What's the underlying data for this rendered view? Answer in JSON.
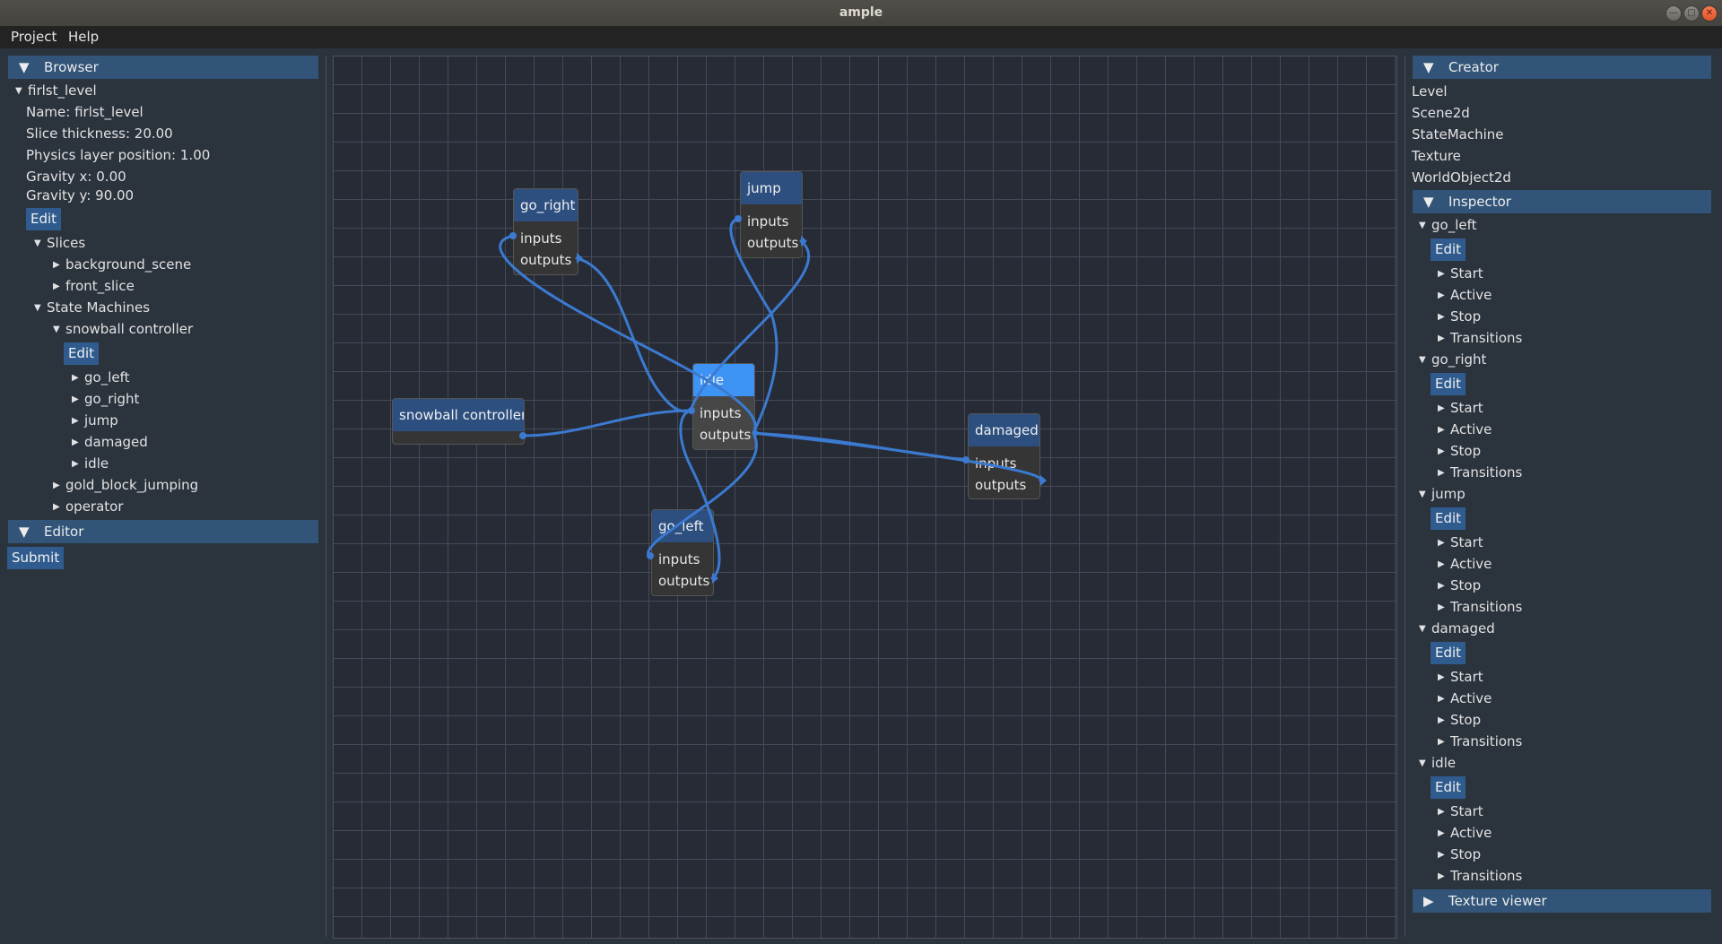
{
  "window": {
    "title": "ample"
  },
  "menubar": {
    "items": [
      "Project",
      "Help"
    ]
  },
  "browser": {
    "header": "Browser",
    "level": {
      "label": "firlst_level",
      "name": "Name: firlst_level",
      "slice_thickness": "Slice thickness: 20.00",
      "physics_layer": "Physics layer position: 1.00",
      "gravity_x": "Gravity x: 0.00",
      "gravity_y": "Gravity y: 90.00",
      "edit": "Edit"
    },
    "slices": {
      "label": "Slices",
      "items": [
        "background_scene",
        "front_slice"
      ]
    },
    "state_machines": {
      "label": "State Machines",
      "snowball": {
        "label": "snowball controller",
        "edit": "Edit",
        "states": [
          "go_left",
          "go_right",
          "jump",
          "damaged",
          "idle"
        ]
      },
      "others": [
        "gold_block_jumping",
        "operator"
      ]
    }
  },
  "editor": {
    "header": "Editor",
    "submit": "Submit"
  },
  "creator": {
    "header": "Creator",
    "items": [
      "Level",
      "Scene2d",
      "StateMachine",
      "Texture",
      "WorldObject2d"
    ]
  },
  "inspector": {
    "header": "Inspector",
    "edit": "Edit",
    "sub_items": [
      "Start",
      "Active",
      "Stop",
      "Transitions"
    ],
    "states": [
      "go_left",
      "go_right",
      "jump",
      "damaged",
      "idle"
    ]
  },
  "texture_viewer": {
    "header": "Texture viewer"
  },
  "graph": {
    "pin_inputs": "inputs",
    "pin_outputs": "outputs",
    "nodes": {
      "go_right": "go_right",
      "jump": "jump",
      "idle": "idle",
      "snowball": "snowball controller",
      "damaged": "damaged",
      "go_left": "go_left"
    },
    "selected_node": "idle",
    "colors": {
      "wire": "#3b7ad0",
      "header": "#2c4f80",
      "selected_header": "#3e94f5",
      "panel_header": "#315478",
      "button": "#2f5b8e"
    }
  }
}
